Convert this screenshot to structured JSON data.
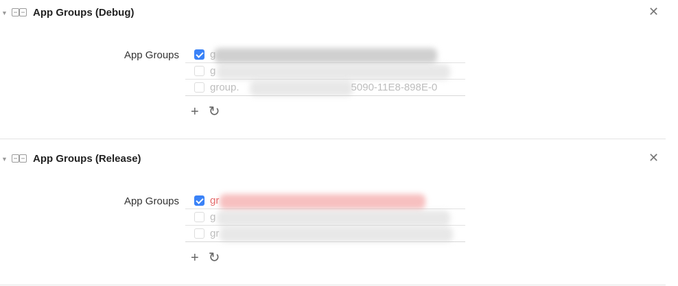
{
  "sections": [
    {
      "title": "App Groups (Debug)",
      "field_label": "App Groups",
      "rows": [
        {
          "checked": true,
          "text": "g"
        },
        {
          "checked": false,
          "text": "g"
        },
        {
          "checked": false,
          "text": "group.",
          "suffix": "5090-11E8-898E-0"
        }
      ]
    },
    {
      "title": "App Groups (Release)",
      "field_label": "App Groups",
      "rows": [
        {
          "checked": true,
          "text": "gr"
        },
        {
          "checked": false,
          "text": "g"
        },
        {
          "checked": false,
          "text": "gr"
        }
      ]
    }
  ],
  "icons": {
    "disclosure": "disclosure-triangle-icon",
    "capability": "app-groups-capability-icon",
    "close": "close-icon",
    "add": "plus-icon",
    "refresh": "refresh-icon"
  },
  "colors": {
    "checkbox_checked": "#3a82f7",
    "error_text": "#e56b6b"
  }
}
